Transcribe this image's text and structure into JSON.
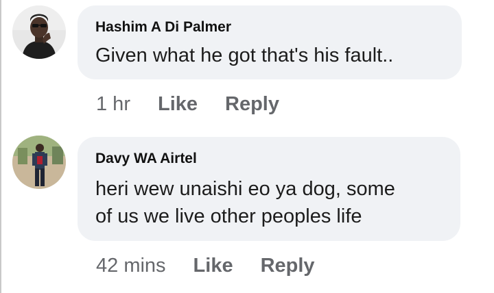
{
  "comments": [
    {
      "author": "Hashim A Di Palmer",
      "text_lines": [
        "Given what he got that's his fault.."
      ],
      "time": "1 hr",
      "like_label": "Like",
      "reply_label": "Reply"
    },
    {
      "author": "Davy WA Airtel",
      "text_lines": [
        "heri wew unaishi eo ya dog, some",
        "of us we  live other peoples life"
      ],
      "time": "42 mins",
      "like_label": "Like",
      "reply_label": "Reply"
    }
  ],
  "colors": {
    "bubble_bg": "#f0f2f5",
    "meta_text": "#65676b"
  }
}
